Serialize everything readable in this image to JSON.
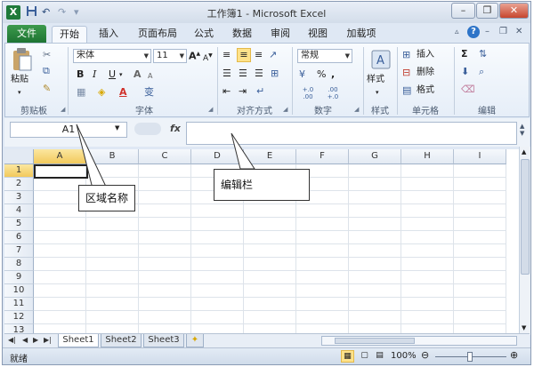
{
  "title": "工作簿1 - Microsoft Excel",
  "app_icon": "X",
  "quick_access": [
    "save-icon",
    "undo-icon",
    "redo-icon",
    "customize-icon"
  ],
  "window_buttons": [
    "minimize-icon",
    "restore-icon",
    "close-icon"
  ],
  "tabs": [
    "文件",
    "开始",
    "插入",
    "页面布局",
    "公式",
    "数据",
    "审阅",
    "视图",
    "加载项"
  ],
  "active_tab": "开始",
  "ribbon": {
    "clipboard": {
      "paste": "粘贴",
      "label": "剪贴板"
    },
    "font": {
      "name": "宋体",
      "size": "11",
      "label": "字体",
      "bold": "B",
      "italic": "I",
      "underline": "U",
      "grow": "A",
      "shrink": "A",
      "wen": "变"
    },
    "alignment": {
      "label": "对齐方式"
    },
    "number": {
      "format": "常规",
      "percent": "%",
      "comma": ",",
      "label": "数字",
      "inc": "+.0 .00",
      "dec": ".00 +.0"
    },
    "styles": {
      "label": "样式",
      "button": "样式"
    },
    "cells": {
      "insert": "插入",
      "delete": "删除",
      "format": "格式",
      "label": "单元格"
    },
    "editing": {
      "label": "编辑",
      "sum": "Σ"
    }
  },
  "formula_bar": {
    "name_box": "A1",
    "fx": "fx",
    "content": ""
  },
  "columns": [
    "A",
    "B",
    "C",
    "D",
    "E",
    "F",
    "G",
    "H",
    "I"
  ],
  "rows": [
    "1",
    "2",
    "3",
    "4",
    "5",
    "6",
    "7",
    "8",
    "9",
    "10",
    "11",
    "12",
    "13"
  ],
  "sheets": [
    "Sheet1",
    "Sheet2",
    "Sheet3"
  ],
  "active_sheet": "Sheet1",
  "status": {
    "text": "就绪",
    "zoom": "100%"
  },
  "callouts": {
    "name_box": "区域名称",
    "formula_bar": "编辑栏"
  },
  "colors": {
    "file_tab": "#1e7433",
    "selection": "#f2c95c",
    "frame": "#8a9bb4"
  }
}
